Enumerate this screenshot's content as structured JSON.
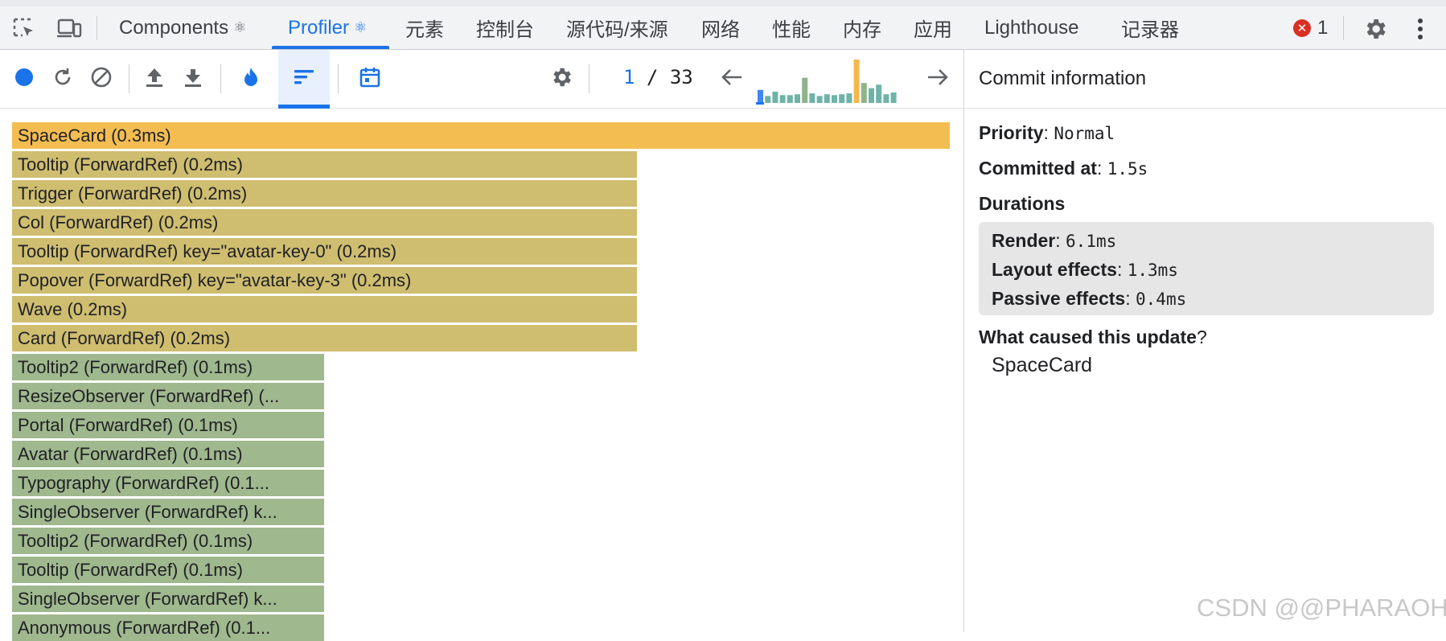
{
  "tabs": [
    {
      "label": "Components",
      "react": true
    },
    {
      "label": "Profiler",
      "react": true,
      "active": true
    },
    {
      "label": "元素"
    },
    {
      "label": "控制台"
    },
    {
      "label": "源代码/来源"
    },
    {
      "label": "网络"
    },
    {
      "label": "性能"
    },
    {
      "label": "内存"
    },
    {
      "label": "应用"
    },
    {
      "label": "Lighthouse"
    },
    {
      "label": "记录器"
    }
  ],
  "react_glyph": "⚛",
  "error_count": "1",
  "error_icon_glyph": "✕",
  "commit_nav": {
    "current": "1",
    "separator": " / ",
    "total": "33"
  },
  "commit_bars": [
    {
      "value": 0.3,
      "color": "#4285f4"
    },
    {
      "value": 0.16,
      "color": "#6fb3a8"
    },
    {
      "value": 0.26,
      "color": "#6fb3a8"
    },
    {
      "value": 0.18,
      "color": "#6fb3a8"
    },
    {
      "value": 0.18,
      "color": "#6fb3a8"
    },
    {
      "value": 0.2,
      "color": "#6fb3a8"
    },
    {
      "value": 0.58,
      "color": "#8fb38a"
    },
    {
      "value": 0.22,
      "color": "#6fb3a8"
    },
    {
      "value": 0.16,
      "color": "#6fb3a8"
    },
    {
      "value": 0.2,
      "color": "#6fb3a8"
    },
    {
      "value": 0.18,
      "color": "#6fb3a8"
    },
    {
      "value": 0.2,
      "color": "#6fb3a8"
    },
    {
      "value": 0.22,
      "color": "#6fb3a8"
    },
    {
      "value": 1.0,
      "color": "#f2b94a"
    },
    {
      "value": 0.46,
      "color": "#8fb38a"
    },
    {
      "value": 0.34,
      "color": "#6fb3a8"
    },
    {
      "value": 0.42,
      "color": "#6fb3a8"
    },
    {
      "value": 0.2,
      "color": "#6fb3a8"
    },
    {
      "value": 0.24,
      "color": "#6fb3a8"
    }
  ],
  "flame_rows": [
    {
      "label": "SpaceCard (0.3ms)",
      "width_fraction": 1.0,
      "color": "#f4bd52"
    },
    {
      "label": "Tooltip (ForwardRef) (0.2ms)",
      "width_fraction": 0.666,
      "color": "#cfbd70"
    },
    {
      "label": "Trigger (ForwardRef) (0.2ms)",
      "width_fraction": 0.666,
      "color": "#cfbd70"
    },
    {
      "label": "Col (ForwardRef) (0.2ms)",
      "width_fraction": 0.666,
      "color": "#cfbd70"
    },
    {
      "label": "Tooltip (ForwardRef) key=\"avatar-key-0\" (0.2ms)",
      "width_fraction": 0.666,
      "color": "#cfbd70"
    },
    {
      "label": "Popover (ForwardRef) key=\"avatar-key-3\" (0.2ms)",
      "width_fraction": 0.666,
      "color": "#cfbd70"
    },
    {
      "label": "Wave (0.2ms)",
      "width_fraction": 0.666,
      "color": "#cfbd70"
    },
    {
      "label": "Card (ForwardRef) (0.2ms)",
      "width_fraction": 0.666,
      "color": "#cfbd70"
    },
    {
      "label": "Tooltip2 (ForwardRef) (0.1ms)",
      "width_fraction": 0.333,
      "color": "#9fb88e"
    },
    {
      "label": "ResizeObserver (ForwardRef) (...",
      "width_fraction": 0.333,
      "color": "#9fb88e"
    },
    {
      "label": "Portal (ForwardRef) (0.1ms)",
      "width_fraction": 0.333,
      "color": "#9fb88e"
    },
    {
      "label": "Avatar (ForwardRef) (0.1ms)",
      "width_fraction": 0.333,
      "color": "#9fb88e"
    },
    {
      "label": "Typography (ForwardRef) (0.1...",
      "width_fraction": 0.333,
      "color": "#9fb88e"
    },
    {
      "label": "SingleObserver (ForwardRef) k...",
      "width_fraction": 0.333,
      "color": "#9fb88e"
    },
    {
      "label": "Tooltip2 (ForwardRef) (0.1ms)",
      "width_fraction": 0.333,
      "color": "#9fb88e"
    },
    {
      "label": "Tooltip (ForwardRef) (0.1ms)",
      "width_fraction": 0.333,
      "color": "#9fb88e"
    },
    {
      "label": "SingleObserver (ForwardRef) k...",
      "width_fraction": 0.333,
      "color": "#9fb88e"
    },
    {
      "label": "Anonymous (ForwardRef) (0.1...",
      "width_fraction": 0.333,
      "color": "#9fb88e"
    }
  ],
  "commit_info": {
    "title": "Commit information",
    "priority_label": "Priority",
    "priority_value": "Normal",
    "committed_label": "Committed at",
    "committed_value": "1.5s",
    "durations_label": "Durations",
    "render_label": "Render",
    "render_value": "6.1ms",
    "layout_label": "Layout effects",
    "layout_value": "1.3ms",
    "passive_label": "Passive effects",
    "passive_value": "0.4ms",
    "cause_label": "What caused this update",
    "cause_value": "SpaceCard"
  },
  "watermark": "CSDN @@PHARAOH",
  "colors": {
    "accent": "#1a73e8",
    "error": "#d93025",
    "flame_root": "#f4bd52"
  }
}
